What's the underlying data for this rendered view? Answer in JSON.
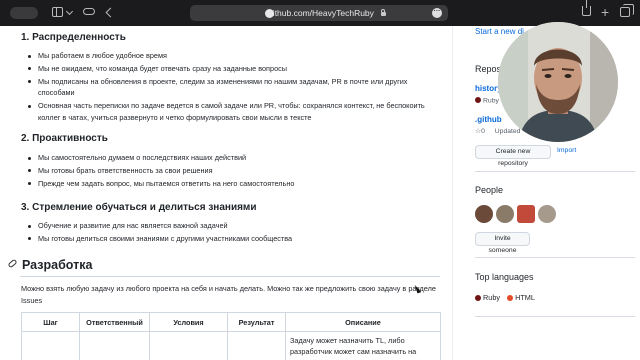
{
  "browser": {
    "url": "github.com/HeavyTechRuby"
  },
  "main": {
    "s1_title": "1. Распределенность",
    "s1_items": [
      "Мы работаем в любое удобное время",
      "Мы не ожидаем, что команда будет отвечать сразу на заданные вопросы",
      "Мы подписаны на обновления в проекте, следим за изменениями по нашим задачам, PR в почте или других способами",
      "Основная часть переписки по задаче ведется в самой задаче или PR, чтобы: сохранялся контекст, не беспокоить коллег в чатах, учиться развернуто и четко формулировать свои мысли в тексте"
    ],
    "s2_title": "2. Проактивность",
    "s2_items": [
      "Мы самостоятельно думаем о последствиях наших действий",
      "Мы готовы брать ответственность за свои решения",
      "Прежде чем задать вопрос, мы пытаемся ответить на него самостоятельно"
    ],
    "s3_title": "3. Стремление обучаться и делиться знаниями",
    "s3_items": [
      "Обучение и развитие для нас является важной задачей",
      "Мы готовы делиться своими знаниями с другими участниками сообщества"
    ],
    "dev_title": "Разработка",
    "dev_para": "Можно взять любую задачу из любого проекта на себя и начать делать. Можно так же предложить свою задачу в разделе Issues",
    "table": {
      "headers": [
        "Шаг",
        "Ответственный",
        "Условия",
        "Результат",
        "Описание"
      ],
      "row1": {
        "result": "",
        "desc": "Задачу может назначить TL, либо разработчик может сам назначить на"
      }
    }
  },
  "sidebar": {
    "start_discussion": "Start a new di",
    "repos_title": "Reposito",
    "repo1_name": "history",
    "repo1_lang": "Ruby",
    "repo2_name": ".github",
    "repo2_stars": "0",
    "repo2_updated": "Updated",
    "create_repo_btn": "Create new repository",
    "import_btn": "Import",
    "people_title": "People",
    "invite_btn": "Invite someone",
    "languages_title": "Top languages",
    "lang1": "Ruby",
    "lang2": "HTML",
    "colors": {
      "ruby": "#701516",
      "html": "#e34c26",
      "link": "#0969da"
    }
  }
}
